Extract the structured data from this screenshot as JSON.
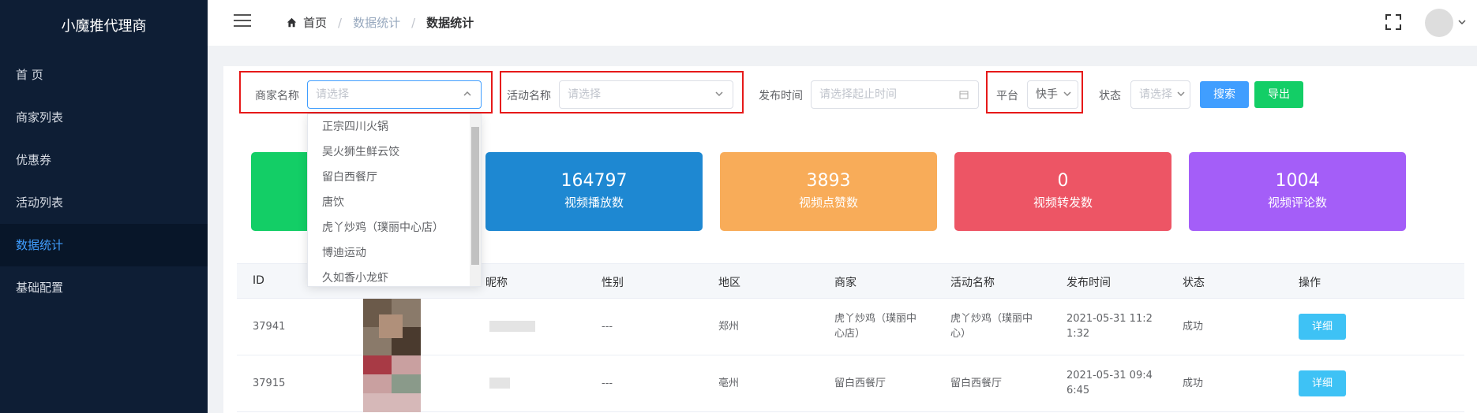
{
  "sidebar": {
    "brand": "小魔推代理商",
    "items": [
      {
        "label": "首 页"
      },
      {
        "label": "商家列表"
      },
      {
        "label": "优惠券"
      },
      {
        "label": "活动列表"
      },
      {
        "label": "数据统计"
      },
      {
        "label": "基础配置"
      }
    ],
    "active_index": 4,
    "active_color": "#409eff"
  },
  "header": {
    "breadcrumb": [
      "首页",
      "数据统计",
      "数据统计"
    ]
  },
  "filters": {
    "merchant_label": "商家名称",
    "merchant_placeholder": "请选择",
    "activity_label": "活动名称",
    "activity_placeholder": "请选择",
    "publish_label": "发布时间",
    "publish_placeholder": "请选择起止时间",
    "platform_label": "平台",
    "platform_value": "快手",
    "status_label": "状态",
    "status_placeholder": "请选择",
    "search_button": "搜索",
    "export_button": "导出"
  },
  "dropdown": {
    "options": [
      "正宗四川火锅",
      "吴火狮生鲜云饺",
      "留白西餐厅",
      "唐饮",
      "虎丫炒鸡（璞丽中心店）",
      "博迪运动",
      "久如香小龙虾"
    ]
  },
  "stats": [
    {
      "value": "",
      "label": "",
      "color": "#13ce66"
    },
    {
      "value": "164797",
      "label": "视频播放数",
      "color": "#1e88d2"
    },
    {
      "value": "3893",
      "label": "视频点赞数",
      "color": "#f8ac59"
    },
    {
      "value": "0",
      "label": "视频转发数",
      "color": "#ed5565"
    },
    {
      "value": "1004",
      "label": "视频评论数",
      "color": "#a45ef8"
    }
  ],
  "table": {
    "headers": [
      "ID",
      "昵称",
      "性别",
      "地区",
      "商家",
      "活动名称",
      "发布时间",
      "状态",
      "操作"
    ],
    "rows": [
      {
        "id": "37941",
        "gender": "---",
        "region": "郑州",
        "merchant": "虎丫炒鸡（璞丽中心店）",
        "activity": "虎丫炒鸡（璞丽中心）",
        "time": "2021-05-31 11:21:32",
        "status": "成功",
        "action": "详细"
      },
      {
        "id": "37915",
        "gender": "---",
        "region": "亳州",
        "merchant": "留白西餐厅",
        "activity": "留白西餐厅",
        "time": "2021-05-31 09:46:45",
        "status": "成功",
        "action": "详细"
      }
    ]
  }
}
